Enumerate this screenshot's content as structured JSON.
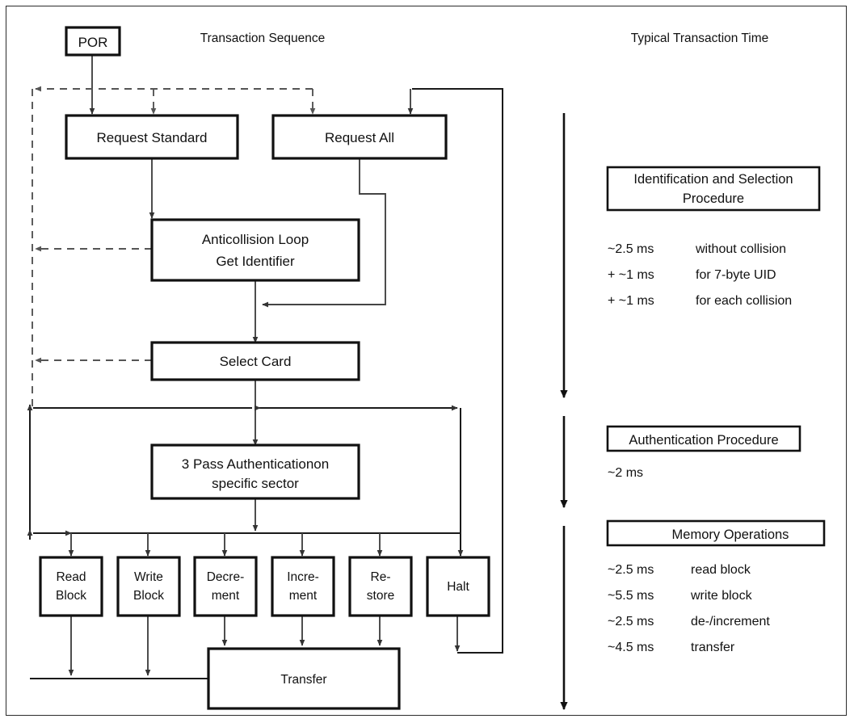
{
  "headers": {
    "left": "Transaction Sequence",
    "right": "Typical Transaction Time"
  },
  "nodes": {
    "por": "POR",
    "request_standard": "Request Standard",
    "request_all": "Request All",
    "anticollision_line1": "Anticollision Loop",
    "anticollision_line2": "Get Identifier",
    "select_card": "Select Card",
    "auth_line1": "3 Pass Authenticationon",
    "auth_line2": "specific sector",
    "read_line1": "Read",
    "read_line2": "Block",
    "write_line1": "Write",
    "write_line2": "Block",
    "decrement_line1": "Decre-",
    "decrement_line2": "ment",
    "increment_line1": "Incre-",
    "increment_line2": "ment",
    "restore_line1": "Re-",
    "restore_line2": "store",
    "halt": "Halt",
    "transfer": "Transfer"
  },
  "timing": {
    "identification": {
      "title_line1": "Identification and Selection",
      "title_line2": "Procedure",
      "rows": [
        {
          "value": "~2.5 ms",
          "desc": "without collision"
        },
        {
          "value": "+ ~1 ms",
          "desc": "for 7-byte UID"
        },
        {
          "value": "+ ~1 ms",
          "desc": "for each collision"
        }
      ]
    },
    "authentication": {
      "title": "Authentication Procedure",
      "rows": [
        {
          "value": "~2 ms",
          "desc": ""
        }
      ]
    },
    "memory": {
      "title": "Memory Operations",
      "rows": [
        {
          "value": "~2.5 ms",
          "desc": "read block"
        },
        {
          "value": "~5.5 ms",
          "desc": "write block"
        },
        {
          "value": "~2.5 ms",
          "desc": "de-/increment"
        },
        {
          "value": "~4.5 ms",
          "desc": "transfer"
        }
      ]
    }
  },
  "colors": {
    "line": "#444444",
    "box_stroke": "#111111",
    "text": "#111111",
    "background": "#ffffff",
    "frame": "#2b2b2b"
  }
}
